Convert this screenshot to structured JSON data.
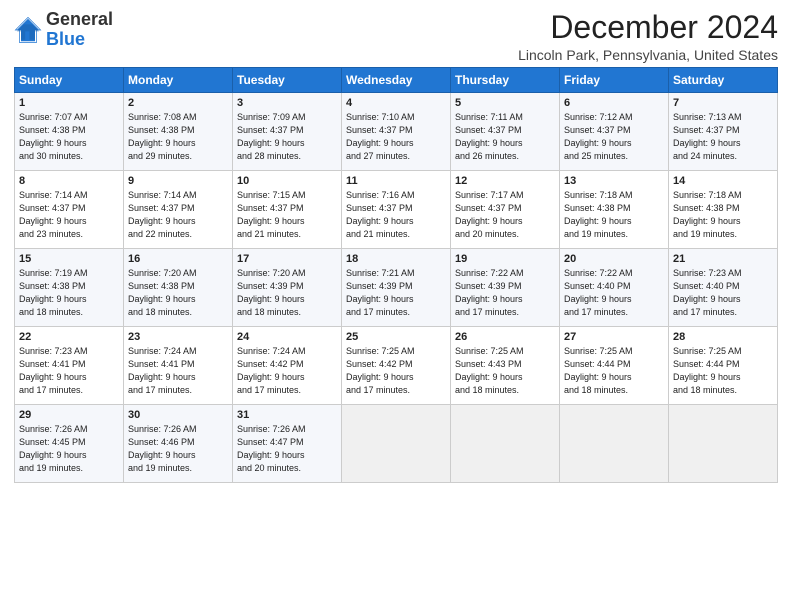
{
  "logo": {
    "general": "General",
    "blue": "Blue"
  },
  "title": "December 2024",
  "location": "Lincoln Park, Pennsylvania, United States",
  "days_of_week": [
    "Sunday",
    "Monday",
    "Tuesday",
    "Wednesday",
    "Thursday",
    "Friday",
    "Saturday"
  ],
  "weeks": [
    [
      {
        "day": "1",
        "info": "Sunrise: 7:07 AM\nSunset: 4:38 PM\nDaylight: 9 hours\nand 30 minutes."
      },
      {
        "day": "2",
        "info": "Sunrise: 7:08 AM\nSunset: 4:38 PM\nDaylight: 9 hours\nand 29 minutes."
      },
      {
        "day": "3",
        "info": "Sunrise: 7:09 AM\nSunset: 4:37 PM\nDaylight: 9 hours\nand 28 minutes."
      },
      {
        "day": "4",
        "info": "Sunrise: 7:10 AM\nSunset: 4:37 PM\nDaylight: 9 hours\nand 27 minutes."
      },
      {
        "day": "5",
        "info": "Sunrise: 7:11 AM\nSunset: 4:37 PM\nDaylight: 9 hours\nand 26 minutes."
      },
      {
        "day": "6",
        "info": "Sunrise: 7:12 AM\nSunset: 4:37 PM\nDaylight: 9 hours\nand 25 minutes."
      },
      {
        "day": "7",
        "info": "Sunrise: 7:13 AM\nSunset: 4:37 PM\nDaylight: 9 hours\nand 24 minutes."
      }
    ],
    [
      {
        "day": "8",
        "info": "Sunrise: 7:14 AM\nSunset: 4:37 PM\nDaylight: 9 hours\nand 23 minutes."
      },
      {
        "day": "9",
        "info": "Sunrise: 7:14 AM\nSunset: 4:37 PM\nDaylight: 9 hours\nand 22 minutes."
      },
      {
        "day": "10",
        "info": "Sunrise: 7:15 AM\nSunset: 4:37 PM\nDaylight: 9 hours\nand 21 minutes."
      },
      {
        "day": "11",
        "info": "Sunrise: 7:16 AM\nSunset: 4:37 PM\nDaylight: 9 hours\nand 21 minutes."
      },
      {
        "day": "12",
        "info": "Sunrise: 7:17 AM\nSunset: 4:37 PM\nDaylight: 9 hours\nand 20 minutes."
      },
      {
        "day": "13",
        "info": "Sunrise: 7:18 AM\nSunset: 4:38 PM\nDaylight: 9 hours\nand 19 minutes."
      },
      {
        "day": "14",
        "info": "Sunrise: 7:18 AM\nSunset: 4:38 PM\nDaylight: 9 hours\nand 19 minutes."
      }
    ],
    [
      {
        "day": "15",
        "info": "Sunrise: 7:19 AM\nSunset: 4:38 PM\nDaylight: 9 hours\nand 18 minutes."
      },
      {
        "day": "16",
        "info": "Sunrise: 7:20 AM\nSunset: 4:38 PM\nDaylight: 9 hours\nand 18 minutes."
      },
      {
        "day": "17",
        "info": "Sunrise: 7:20 AM\nSunset: 4:39 PM\nDaylight: 9 hours\nand 18 minutes."
      },
      {
        "day": "18",
        "info": "Sunrise: 7:21 AM\nSunset: 4:39 PM\nDaylight: 9 hours\nand 17 minutes."
      },
      {
        "day": "19",
        "info": "Sunrise: 7:22 AM\nSunset: 4:39 PM\nDaylight: 9 hours\nand 17 minutes."
      },
      {
        "day": "20",
        "info": "Sunrise: 7:22 AM\nSunset: 4:40 PM\nDaylight: 9 hours\nand 17 minutes."
      },
      {
        "day": "21",
        "info": "Sunrise: 7:23 AM\nSunset: 4:40 PM\nDaylight: 9 hours\nand 17 minutes."
      }
    ],
    [
      {
        "day": "22",
        "info": "Sunrise: 7:23 AM\nSunset: 4:41 PM\nDaylight: 9 hours\nand 17 minutes."
      },
      {
        "day": "23",
        "info": "Sunrise: 7:24 AM\nSunset: 4:41 PM\nDaylight: 9 hours\nand 17 minutes."
      },
      {
        "day": "24",
        "info": "Sunrise: 7:24 AM\nSunset: 4:42 PM\nDaylight: 9 hours\nand 17 minutes."
      },
      {
        "day": "25",
        "info": "Sunrise: 7:25 AM\nSunset: 4:42 PM\nDaylight: 9 hours\nand 17 minutes."
      },
      {
        "day": "26",
        "info": "Sunrise: 7:25 AM\nSunset: 4:43 PM\nDaylight: 9 hours\nand 18 minutes."
      },
      {
        "day": "27",
        "info": "Sunrise: 7:25 AM\nSunset: 4:44 PM\nDaylight: 9 hours\nand 18 minutes."
      },
      {
        "day": "28",
        "info": "Sunrise: 7:25 AM\nSunset: 4:44 PM\nDaylight: 9 hours\nand 18 minutes."
      }
    ],
    [
      {
        "day": "29",
        "info": "Sunrise: 7:26 AM\nSunset: 4:45 PM\nDaylight: 9 hours\nand 19 minutes."
      },
      {
        "day": "30",
        "info": "Sunrise: 7:26 AM\nSunset: 4:46 PM\nDaylight: 9 hours\nand 19 minutes."
      },
      {
        "day": "31",
        "info": "Sunrise: 7:26 AM\nSunset: 4:47 PM\nDaylight: 9 hours\nand 20 minutes."
      },
      {
        "day": "",
        "info": ""
      },
      {
        "day": "",
        "info": ""
      },
      {
        "day": "",
        "info": ""
      },
      {
        "day": "",
        "info": ""
      }
    ]
  ]
}
